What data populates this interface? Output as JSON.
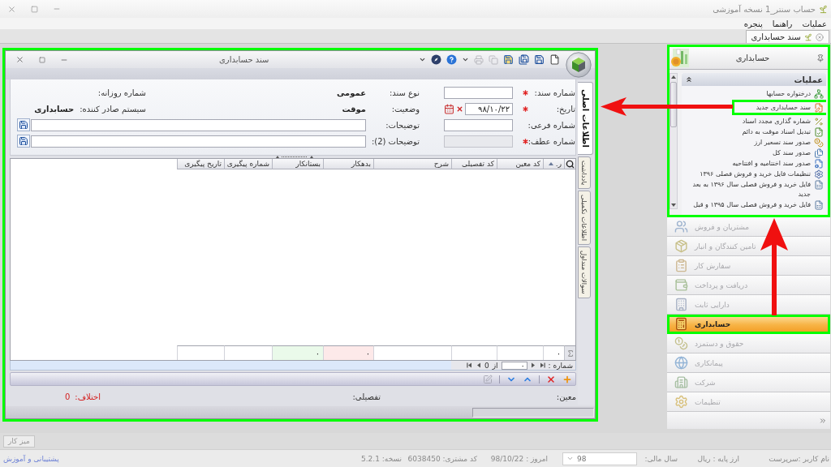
{
  "app_window": {
    "title": "حساب سنتر_1 نسخه آموزشی"
  },
  "menu": [
    {
      "label": "عملیات"
    },
    {
      "label": "راهنما"
    },
    {
      "label": "پنجره"
    }
  ],
  "document_tabs": [
    {
      "label": "سند حسابداری",
      "selected": true
    }
  ],
  "document_window": {
    "title": "سند حسابداری",
    "highlighted": true,
    "toolbar": [
      {
        "kind": "new",
        "disabled": false
      },
      {
        "kind": "save",
        "disabled": false
      },
      {
        "kind": "save_new",
        "disabled": false
      },
      {
        "kind": "save_close",
        "disabled": false
      },
      {
        "kind": "copy",
        "disabled": true
      },
      {
        "kind": "print",
        "disabled": true
      },
      {
        "kind": "dropdown",
        "disabled": false
      },
      {
        "kind": "help",
        "disabled": false
      },
      {
        "kind": "tools",
        "disabled": false
      },
      {
        "kind": "dropdown",
        "disabled": false
      }
    ],
    "side_tabs": [
      {
        "label": "اطلاعات اصلی",
        "selected": true
      },
      {
        "label": "یادداشت",
        "selected": false
      },
      {
        "label": "اطلاعات تکمیلی",
        "selected": false
      },
      {
        "label": "سوالات متداول",
        "selected": false
      }
    ],
    "form": {
      "doc_number": {
        "label": "شماره سند:",
        "required": true,
        "disabled": false
      },
      "date": {
        "label": "تاریخ:",
        "required": true,
        "disabled": false,
        "value": "۹۸/۱۰/۲۲"
      },
      "sub_number": {
        "label": "شماره فرعی:",
        "required": false,
        "disabled": false
      },
      "reference_number": {
        "label": "شماره عطف:",
        "required": true,
        "disabled": true
      },
      "doc_type": {
        "label": "نوع سند:",
        "value": "عمومی"
      },
      "status": {
        "label": "وضعیت:",
        "value": "موقت"
      },
      "daily_number": {
        "label": "شماره روزانه:"
      },
      "issuing_system": {
        "label": "سیستم صادر کننده:",
        "value": "حسابداری"
      },
      "description": {
        "label": "توضیحات:"
      },
      "description_2": {
        "label": "توضیحات (2):"
      }
    },
    "grid": {
      "columns": [
        {
          "label": "ر.",
          "sorted": true,
          "total": "۰"
        },
        {
          "label": "کد معین",
          "sorted": false
        },
        {
          "label": "کد تفصیلی",
          "sorted": false
        },
        {
          "label": "شرح",
          "sorted": false
        },
        {
          "label": "بدهکار",
          "sorted": false,
          "total": "۰",
          "color": "#fde9e9"
        },
        {
          "label": "بستانکار",
          "sorted": false,
          "total": "۰",
          "color": "#eafaea"
        },
        {
          "label": "شماره پیگیری",
          "sorted": false
        },
        {
          "label": "تاریخ پیگیری",
          "sorted": false
        }
      ]
    },
    "navigator": {
      "label": "شماره :",
      "value": "۰",
      "of_label": "از",
      "total": "0"
    },
    "grid_toolbar": [
      [
        {
          "kind": "add",
          "disabled": false
        },
        {
          "kind": "delete",
          "disabled": false
        }
      ],
      [
        {
          "kind": "move_up",
          "disabled": false
        },
        {
          "kind": "move_down",
          "disabled": false
        }
      ],
      [
        {
          "kind": "edit",
          "disabled": true
        }
      ]
    ],
    "summary": {
      "ledger_label": "معین:",
      "detail_label": "تفصیلی:",
      "difference_label": "اختلاف:",
      "difference": "0"
    }
  },
  "sidebar": {
    "title": "حسابداری",
    "highlighted": true,
    "group": {
      "title": "عملیات",
      "expanded": true,
      "items": [
        {
          "label": "درختواره حسابها",
          "highlighted": false
        },
        {
          "label": "سند حسابداری جدید",
          "highlighted": true
        },
        {
          "label": "شماره گذاری مجدد اسناد",
          "highlighted": false
        },
        {
          "label": "تبدیل اسناد موقت به دائم",
          "highlighted": false
        },
        {
          "label": "صدور سند تسعیر ارز",
          "highlighted": false
        },
        {
          "label": "صدور سند کل",
          "highlighted": false
        },
        {
          "label": "صدور سند اختتامیه و افتتاحیه",
          "highlighted": false
        },
        {
          "label": "تنظیمات فایل خرید و فروش فصلی ۱۳۹۶",
          "highlighted": false
        },
        {
          "label": "فایل خرید و فروش فصلی سال ۱۳۹۶ به بعد جدید",
          "highlighted": false
        },
        {
          "label": "فایل خرید و فروش فصلی سال ۱۳۹۵ و قبل",
          "highlighted": false
        }
      ]
    },
    "nav": [
      {
        "label": "مشتریان و فروش",
        "selected": false,
        "highlighted": false
      },
      {
        "label": "تامین کنندگان و انبار",
        "selected": false,
        "highlighted": false
      },
      {
        "label": "سفارش کار",
        "selected": false,
        "highlighted": false
      },
      {
        "label": "دریافت و پرداخت",
        "selected": false,
        "highlighted": false
      },
      {
        "label": "دارایی ثابت",
        "selected": false,
        "highlighted": false
      },
      {
        "label": "حسابداری",
        "selected": true,
        "highlighted": true
      },
      {
        "label": "حقوق و دستمزد",
        "selected": false,
        "highlighted": false
      },
      {
        "label": "پیمانکاری",
        "selected": false,
        "highlighted": false
      },
      {
        "label": "شرکت",
        "selected": false,
        "highlighted": false
      },
      {
        "label": "تنظیمات",
        "selected": false,
        "highlighted": false
      }
    ]
  },
  "desktop_button": "میز کار",
  "status_bar": {
    "user": "نام کاربر :سرپرست",
    "base_currency": "ارز پایه : ریال",
    "fiscal_year_label": "سال مالی:",
    "fiscal_year": "98",
    "today": "امروز : 98/10/22",
    "customer_code": "کد مشتری: 6038450",
    "version": "نسخه: 5.2.1",
    "support_link": "پشتیبانی و آموزش"
  }
}
